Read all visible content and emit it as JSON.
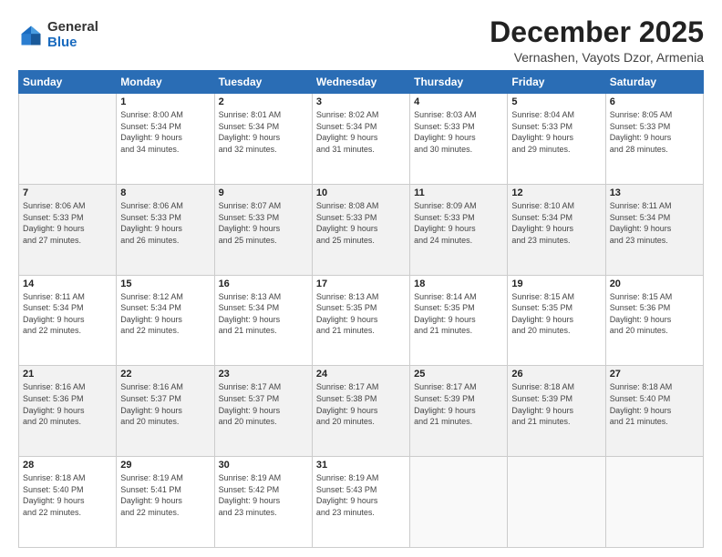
{
  "logo": {
    "general": "General",
    "blue": "Blue"
  },
  "title": "December 2025",
  "location": "Vernashen, Vayots Dzor, Armenia",
  "weekdays": [
    "Sunday",
    "Monday",
    "Tuesday",
    "Wednesday",
    "Thursday",
    "Friday",
    "Saturday"
  ],
  "weeks": [
    [
      {
        "day": "",
        "info": ""
      },
      {
        "day": "1",
        "info": "Sunrise: 8:00 AM\nSunset: 5:34 PM\nDaylight: 9 hours\nand 34 minutes."
      },
      {
        "day": "2",
        "info": "Sunrise: 8:01 AM\nSunset: 5:34 PM\nDaylight: 9 hours\nand 32 minutes."
      },
      {
        "day": "3",
        "info": "Sunrise: 8:02 AM\nSunset: 5:34 PM\nDaylight: 9 hours\nand 31 minutes."
      },
      {
        "day": "4",
        "info": "Sunrise: 8:03 AM\nSunset: 5:33 PM\nDaylight: 9 hours\nand 30 minutes."
      },
      {
        "day": "5",
        "info": "Sunrise: 8:04 AM\nSunset: 5:33 PM\nDaylight: 9 hours\nand 29 minutes."
      },
      {
        "day": "6",
        "info": "Sunrise: 8:05 AM\nSunset: 5:33 PM\nDaylight: 9 hours\nand 28 minutes."
      }
    ],
    [
      {
        "day": "7",
        "info": "Sunrise: 8:06 AM\nSunset: 5:33 PM\nDaylight: 9 hours\nand 27 minutes."
      },
      {
        "day": "8",
        "info": "Sunrise: 8:06 AM\nSunset: 5:33 PM\nDaylight: 9 hours\nand 26 minutes."
      },
      {
        "day": "9",
        "info": "Sunrise: 8:07 AM\nSunset: 5:33 PM\nDaylight: 9 hours\nand 25 minutes."
      },
      {
        "day": "10",
        "info": "Sunrise: 8:08 AM\nSunset: 5:33 PM\nDaylight: 9 hours\nand 25 minutes."
      },
      {
        "day": "11",
        "info": "Sunrise: 8:09 AM\nSunset: 5:33 PM\nDaylight: 9 hours\nand 24 minutes."
      },
      {
        "day": "12",
        "info": "Sunrise: 8:10 AM\nSunset: 5:34 PM\nDaylight: 9 hours\nand 23 minutes."
      },
      {
        "day": "13",
        "info": "Sunrise: 8:11 AM\nSunset: 5:34 PM\nDaylight: 9 hours\nand 23 minutes."
      }
    ],
    [
      {
        "day": "14",
        "info": "Sunrise: 8:11 AM\nSunset: 5:34 PM\nDaylight: 9 hours\nand 22 minutes."
      },
      {
        "day": "15",
        "info": "Sunrise: 8:12 AM\nSunset: 5:34 PM\nDaylight: 9 hours\nand 22 minutes."
      },
      {
        "day": "16",
        "info": "Sunrise: 8:13 AM\nSunset: 5:34 PM\nDaylight: 9 hours\nand 21 minutes."
      },
      {
        "day": "17",
        "info": "Sunrise: 8:13 AM\nSunset: 5:35 PM\nDaylight: 9 hours\nand 21 minutes."
      },
      {
        "day": "18",
        "info": "Sunrise: 8:14 AM\nSunset: 5:35 PM\nDaylight: 9 hours\nand 21 minutes."
      },
      {
        "day": "19",
        "info": "Sunrise: 8:15 AM\nSunset: 5:35 PM\nDaylight: 9 hours\nand 20 minutes."
      },
      {
        "day": "20",
        "info": "Sunrise: 8:15 AM\nSunset: 5:36 PM\nDaylight: 9 hours\nand 20 minutes."
      }
    ],
    [
      {
        "day": "21",
        "info": "Sunrise: 8:16 AM\nSunset: 5:36 PM\nDaylight: 9 hours\nand 20 minutes."
      },
      {
        "day": "22",
        "info": "Sunrise: 8:16 AM\nSunset: 5:37 PM\nDaylight: 9 hours\nand 20 minutes."
      },
      {
        "day": "23",
        "info": "Sunrise: 8:17 AM\nSunset: 5:37 PM\nDaylight: 9 hours\nand 20 minutes."
      },
      {
        "day": "24",
        "info": "Sunrise: 8:17 AM\nSunset: 5:38 PM\nDaylight: 9 hours\nand 20 minutes."
      },
      {
        "day": "25",
        "info": "Sunrise: 8:17 AM\nSunset: 5:39 PM\nDaylight: 9 hours\nand 21 minutes."
      },
      {
        "day": "26",
        "info": "Sunrise: 8:18 AM\nSunset: 5:39 PM\nDaylight: 9 hours\nand 21 minutes."
      },
      {
        "day": "27",
        "info": "Sunrise: 8:18 AM\nSunset: 5:40 PM\nDaylight: 9 hours\nand 21 minutes."
      }
    ],
    [
      {
        "day": "28",
        "info": "Sunrise: 8:18 AM\nSunset: 5:40 PM\nDaylight: 9 hours\nand 22 minutes."
      },
      {
        "day": "29",
        "info": "Sunrise: 8:19 AM\nSunset: 5:41 PM\nDaylight: 9 hours\nand 22 minutes."
      },
      {
        "day": "30",
        "info": "Sunrise: 8:19 AM\nSunset: 5:42 PM\nDaylight: 9 hours\nand 23 minutes."
      },
      {
        "day": "31",
        "info": "Sunrise: 8:19 AM\nSunset: 5:43 PM\nDaylight: 9 hours\nand 23 minutes."
      },
      {
        "day": "",
        "info": ""
      },
      {
        "day": "",
        "info": ""
      },
      {
        "day": "",
        "info": ""
      }
    ]
  ]
}
